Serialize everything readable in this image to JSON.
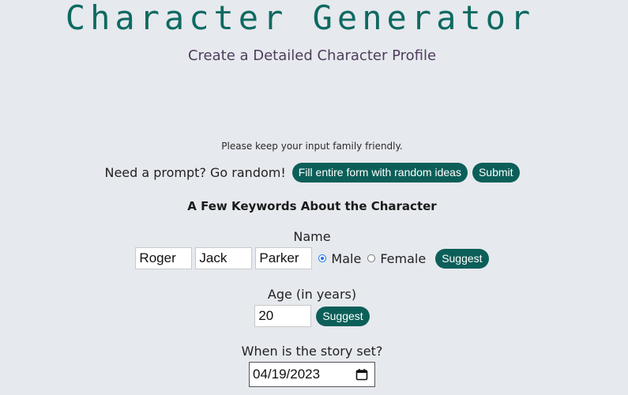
{
  "header": {
    "title": "Character Generator",
    "subtitle": "Create a Detailed Character Profile"
  },
  "notice": "Please keep your input family friendly.",
  "random": {
    "label": "Need a prompt? Go random!",
    "fill_button": "Fill entire form with random ideas",
    "submit_button": "Submit"
  },
  "keywords": {
    "heading": "A Few Keywords About the Character"
  },
  "name": {
    "label": "Name",
    "first": "Roger",
    "middle": "Jack",
    "last": "Parker",
    "gender_options": [
      {
        "label": "Male",
        "selected": true
      },
      {
        "label": "Female",
        "selected": false
      }
    ],
    "suggest_button": "Suggest"
  },
  "age": {
    "label": "Age (in years)",
    "value": "20",
    "suggest_button": "Suggest"
  },
  "setting": {
    "label": "When is the story set?",
    "date_value": "04/19/2023",
    "icon": "calendar-icon"
  },
  "colors": {
    "accent": "#0c5f59",
    "title": "#0e6a61",
    "subtitle": "#4e3d5c",
    "background": "#e6e9ee",
    "radio_selected": "#1a73e8"
  }
}
